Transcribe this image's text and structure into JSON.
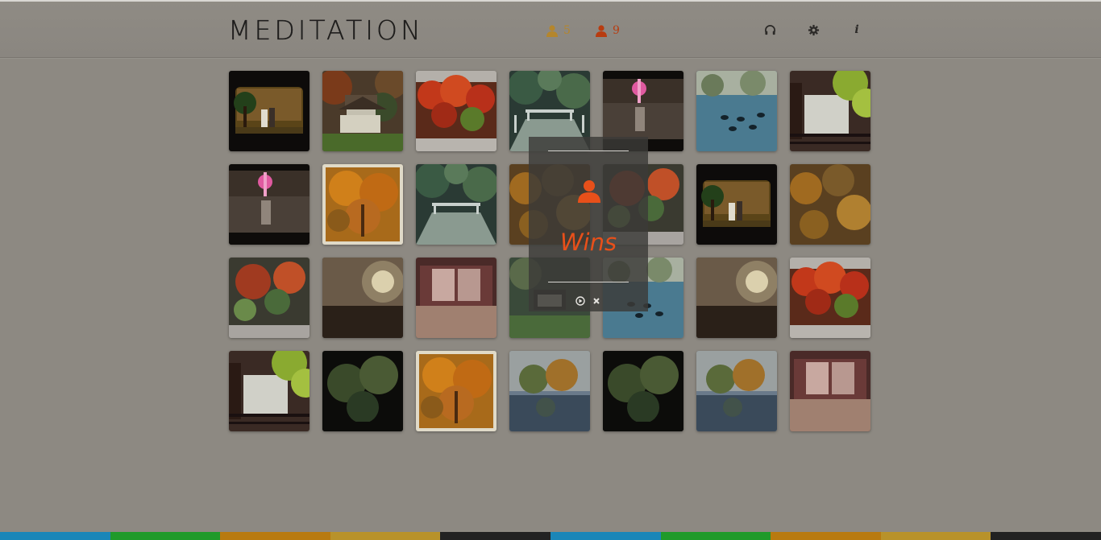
{
  "header": {
    "title": "MEDITATION",
    "player1_score": "5",
    "player2_score": "9",
    "player1_color": "#b4862d",
    "player2_color": "#b83c10",
    "icons": [
      "headphones-icon",
      "gear-icon",
      "info-icon"
    ],
    "info_glyph": "i"
  },
  "board": {
    "rows": 4,
    "columns": 7,
    "tiles": [
      [
        "wedding-photo",
        "japanese-house",
        "red-maple",
        "bridge",
        "sunset-lake",
        "duck-pond",
        "maple-window"
      ],
      [
        "sunset-lake",
        "orange-tree",
        "bridge",
        "autumn-leaves",
        "red-maple-garden",
        "wedding-photo",
        "autumn-leaves"
      ],
      [
        "red-maple-garden",
        "sun-glow",
        "tatami-room",
        "house-pond",
        "duck-pond",
        "sun-glow",
        "red-maple"
      ],
      [
        "maple-window",
        "dark-forest",
        "orange-tree",
        "pond-reflection",
        "dark-forest",
        "pond-reflection",
        "tatami-room"
      ]
    ]
  },
  "result_dialog": {
    "winner_icon": "player-icon",
    "winner_color": "#e8501a",
    "message": "Wins",
    "buttons": [
      "replay-icon",
      "close-icon"
    ]
  },
  "bottom_bar_colors": [
    "#1a86b8",
    "#1f9a2a",
    "#b87a10",
    "#b8922a",
    "#222222",
    "#1a86b8",
    "#1f9a2a",
    "#b87a10",
    "#b8922a",
    "#222222"
  ]
}
